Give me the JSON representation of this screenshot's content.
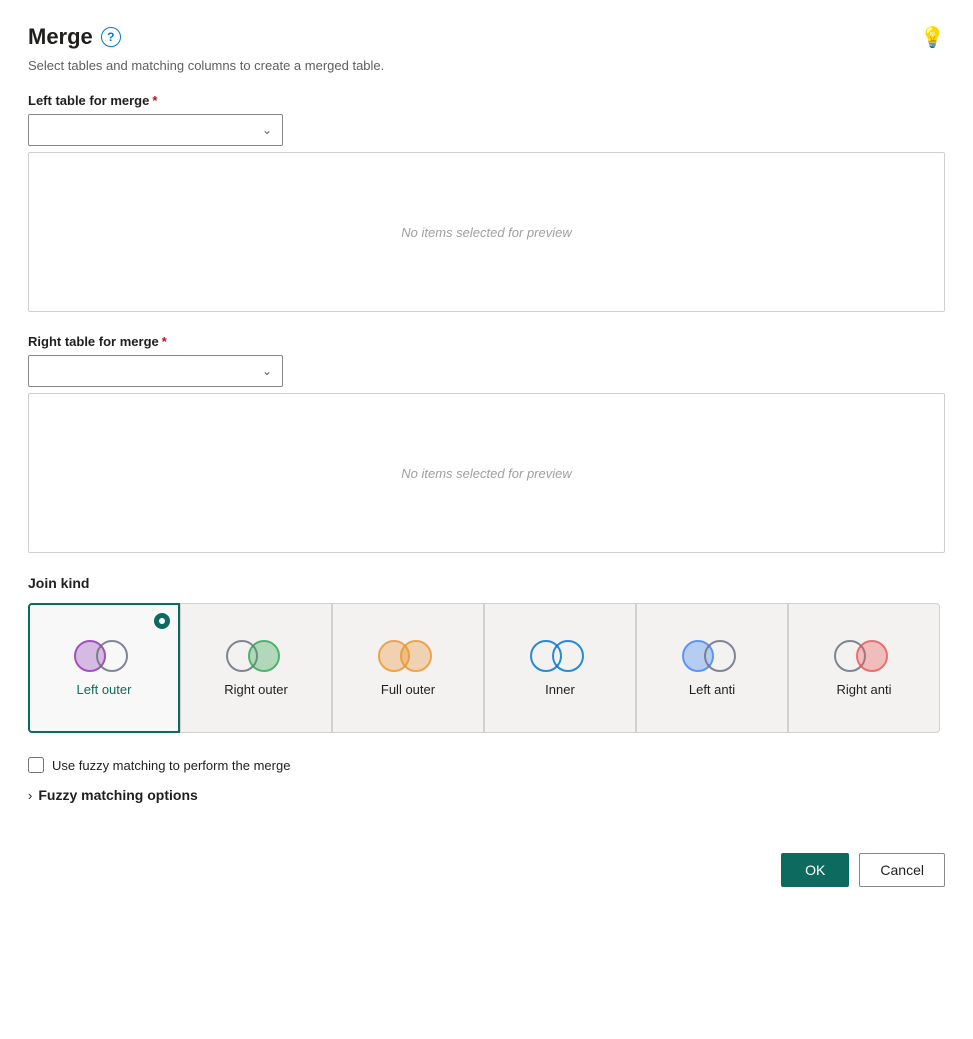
{
  "header": {
    "title": "Merge",
    "help_icon": "?",
    "subtitle": "Select tables and matching columns to create a merged table."
  },
  "left_table": {
    "label": "Left table for merge",
    "required": true,
    "placeholder": "",
    "preview_text": "No items selected for preview"
  },
  "right_table": {
    "label": "Right table for merge",
    "required": true,
    "placeholder": "",
    "preview_text": "No items selected for preview"
  },
  "join_kind": {
    "label": "Join kind",
    "options": [
      {
        "id": "left-outer",
        "label": "Left outer",
        "selected": true
      },
      {
        "id": "right-outer",
        "label": "Right outer",
        "selected": false
      },
      {
        "id": "full-outer",
        "label": "Full outer",
        "selected": false
      },
      {
        "id": "inner",
        "label": "Inner",
        "selected": false
      },
      {
        "id": "left-anti",
        "label": "Left anti",
        "selected": false
      },
      {
        "id": "right-anti",
        "label": "Right anti",
        "selected": false
      }
    ]
  },
  "fuzzy": {
    "checkbox_label": "Use fuzzy matching to perform the merge",
    "options_label": "Fuzzy matching options",
    "checked": false
  },
  "buttons": {
    "ok": "OK",
    "cancel": "Cancel"
  }
}
